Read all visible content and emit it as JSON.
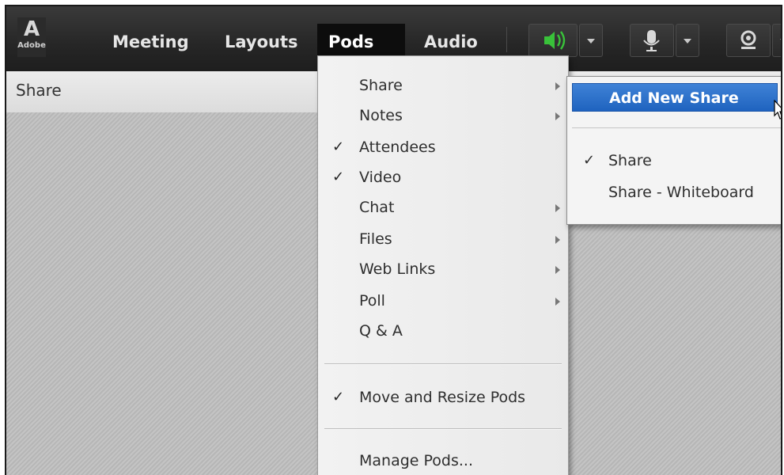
{
  "logo": {
    "mark": "A",
    "word": "Adobe"
  },
  "menubar": {
    "items": [
      {
        "label": "Meeting"
      },
      {
        "label": "Layouts"
      },
      {
        "label": "Pods"
      },
      {
        "label": "Audio"
      }
    ],
    "active": "Pods",
    "toolbar": [
      {
        "icon": "speaker-icon",
        "state": "on",
        "color": "#39c23a"
      },
      {
        "icon": "microphone-icon"
      },
      {
        "icon": "webcam-icon"
      }
    ]
  },
  "pod": {
    "title": "Share"
  },
  "pods_menu": {
    "items": [
      {
        "label": "Share",
        "checked": false,
        "submenu": true
      },
      {
        "label": "Notes",
        "checked": false,
        "submenu": true
      },
      {
        "label": "Attendees",
        "checked": true,
        "submenu": false
      },
      {
        "label": "Video",
        "checked": true,
        "submenu": false
      },
      {
        "label": "Chat",
        "checked": false,
        "submenu": true
      },
      {
        "label": "Files",
        "checked": false,
        "submenu": true
      },
      {
        "label": "Web Links",
        "checked": false,
        "submenu": true
      },
      {
        "label": "Poll",
        "checked": false,
        "submenu": true
      },
      {
        "label": "Q & A",
        "checked": false,
        "submenu": false
      }
    ],
    "move_resize": {
      "label": "Move and Resize Pods",
      "checked": true
    },
    "manage": {
      "label": "Manage Pods..."
    }
  },
  "share_submenu": {
    "highlighted": {
      "label": "Add New Share"
    },
    "items": [
      {
        "label": "Share",
        "checked": true
      },
      {
        "label": "Share - Whiteboard",
        "checked": false
      }
    ],
    "highlight_color": "#2a6fcf"
  },
  "check_glyph": "✓"
}
